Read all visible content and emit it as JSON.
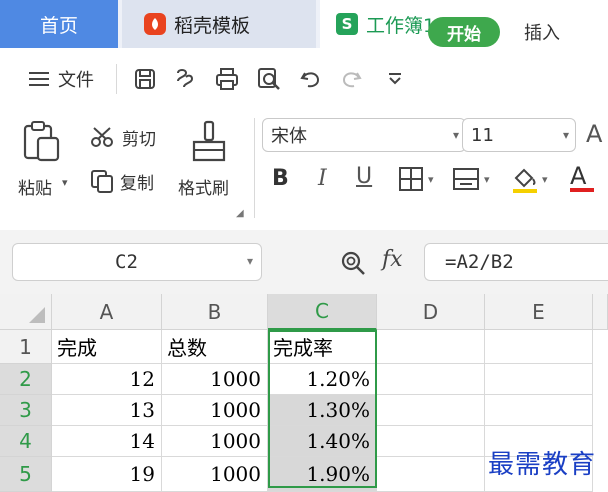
{
  "tabs": {
    "home": "首页",
    "daoke": "稻壳模板",
    "workbook": "工作簿1",
    "workbook_icon": "S"
  },
  "menu": {
    "hamburger_icon": "menu-icon",
    "file": "文件",
    "start": "开始",
    "insert": "插入"
  },
  "ribbon": {
    "paste": "粘贴",
    "cut": "剪切",
    "copy": "复制",
    "format_painter": "格式刷",
    "font_name": "宋体",
    "font_size": "11",
    "bold": "B",
    "italic": "I",
    "underline": "U",
    "font_color": "A",
    "accent_colors": {
      "underline_red": "#e02020",
      "fill_yellow": "#f5d000"
    }
  },
  "formula_bar": {
    "cell_ref": "C2",
    "fx": "fx",
    "formula": "=A2/B2"
  },
  "grid": {
    "columns": [
      "A",
      "B",
      "C",
      "D",
      "E"
    ],
    "rows": [
      "1",
      "2",
      "3",
      "4",
      "5"
    ],
    "cells": {
      "A1": "完成",
      "B1": "总数",
      "C1": "完成率",
      "A2": "12",
      "B2": "1000",
      "C2": "1.20%",
      "A3": "13",
      "B3": "1000",
      "C3": "1.30%",
      "A4": "14",
      "B4": "1000",
      "C4": "1.40%",
      "A5": "19",
      "B5": "1000",
      "C5": "1.90%"
    }
  },
  "watermark": "最需教育",
  "colors": {
    "tab_home_bg": "#4f89e3",
    "start_button_bg": "#3ea84d",
    "selection_border": "#2f9a48",
    "workbook_text": "#1c9a54"
  }
}
